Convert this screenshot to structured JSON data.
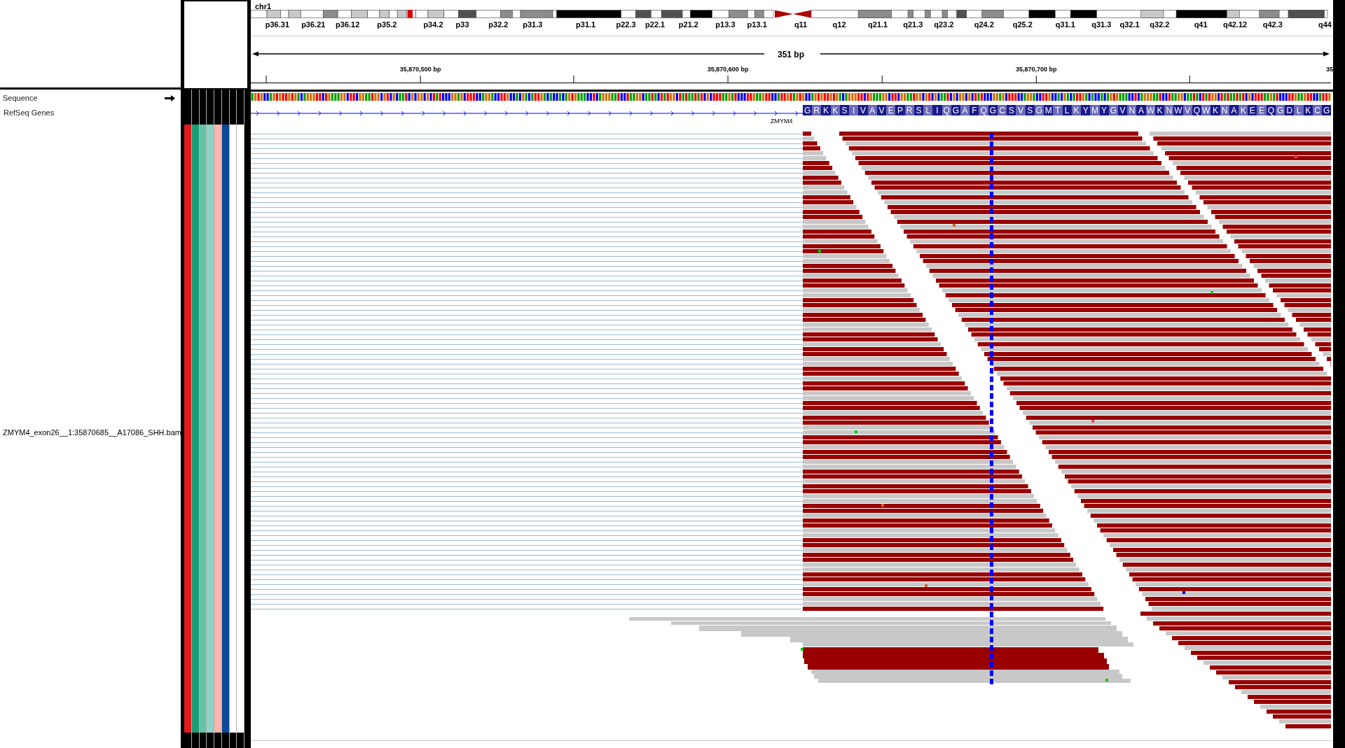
{
  "ideogram": {
    "chromosome": "chr1",
    "bands": [
      "p36.31",
      "p36.21",
      "p36.12",
      "p35.2",
      "p34.2",
      "p33",
      "p32.2",
      "p31.3",
      "p31.1",
      "p22.3",
      "p22.1",
      "p21.2",
      "p13.3",
      "p13.1",
      "q11",
      "q12",
      "q21.1",
      "q21.3",
      "q23.2",
      "q24.2",
      "q25.2",
      "q31.1",
      "q31.3",
      "q32.1",
      "q32.2",
      "q41",
      "q42.12",
      "q42.3",
      "q44"
    ]
  },
  "ruler": {
    "span": "351 bp",
    "ticks": [
      "35,870,500 bp",
      "35,870,600 bp",
      "35,870,700 bp",
      "35"
    ]
  },
  "attributes": [
    {
      "color": "#e31a1c"
    },
    {
      "color": "#1b9e77"
    },
    {
      "color": "#66c2a5"
    },
    {
      "color": "#8dd3c7"
    },
    {
      "color": "#fbb4ae"
    },
    {
      "color": "#0b4a98"
    },
    {
      "color": "#ffffff"
    },
    {
      "color": "#ffffff"
    }
  ],
  "tracks": [
    {
      "kind": "sequence",
      "name": "Sequence"
    },
    {
      "kind": "gene",
      "name": "RefSeq Genes",
      "gene": "ZMYM4",
      "amino_acids": [
        "G",
        "R",
        "K",
        "K",
        "S",
        "I",
        "V",
        "A",
        "V",
        "E",
        "P",
        "R",
        "S",
        "L",
        "I",
        "Q",
        "G",
        "A",
        "F",
        "Q",
        "G",
        "C",
        "S",
        "V",
        "S",
        "G",
        "M",
        "T",
        "L",
        "K",
        "Y",
        "M",
        "Y",
        "G",
        "V",
        "N",
        "A",
        "W",
        "K",
        "N",
        "W",
        "V",
        "Q",
        "W",
        "K",
        "N",
        "A",
        "K",
        "E",
        "E",
        "Q",
        "G",
        "D",
        "L",
        "K",
        "C",
        "G"
      ]
    },
    {
      "kind": "alignment",
      "name": "ZMYM4_exon26__1:35870685__A17086_SHH.bam"
    }
  ]
}
